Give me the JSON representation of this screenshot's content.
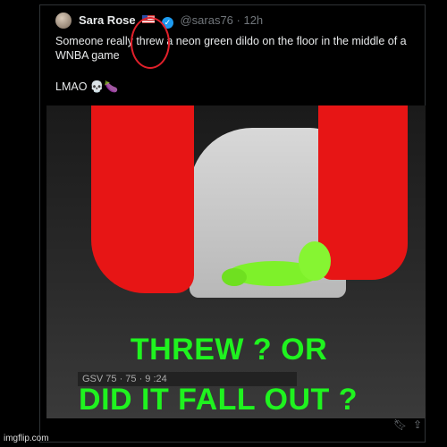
{
  "post": {
    "name": "Sara Rose",
    "handle": "@saras76 · 12h",
    "text_lines": [
      "Someone really threw a neon green dildo on the floor in the middle of a",
      "WNBA game"
    ],
    "reply": "LMAO 💀🍆"
  },
  "meme": {
    "line1": "THREW ? OR",
    "line2": "DID IT FALL OUT ?",
    "color": "#1ff31f"
  },
  "photo": {
    "score_text": "GSV 75 · 75 · 9 :24"
  },
  "watermark": "imgflip.com",
  "colors": {
    "circle": "#e0202a",
    "verified": "#1d9bf0",
    "socks": "#e71515",
    "object": "#7ef12a"
  }
}
